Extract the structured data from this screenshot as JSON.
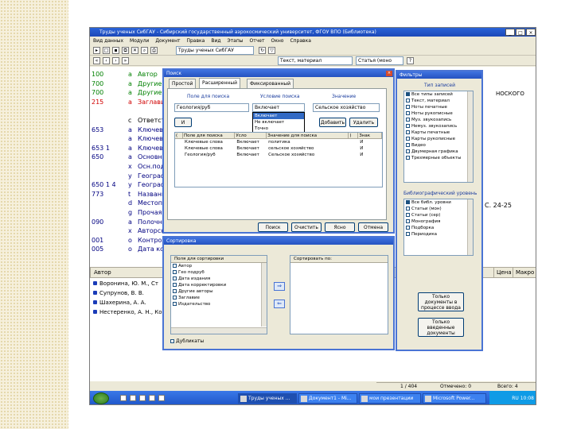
{
  "window": {
    "title": "Труды ученых СибГАУ - Сибирский государственный аэрокосмический университет, ФГОУ ВПО (Библиотека)",
    "menu": [
      "Вид данных",
      "Модули",
      "Документ",
      "Правка",
      "Вид",
      "Этапы",
      "Отчет",
      "Окно",
      "Справка"
    ],
    "toolbar_combo": "Труды ученых СибГАУ",
    "toolbar_combo2": "Текст, материал",
    "toolbar_combo3": "Статья (моно",
    "min": "_",
    "max": "□",
    "close": "×"
  },
  "records": [
    {
      "code": "100",
      "let": "а",
      "text": "Автор",
      "color": "#008000"
    },
    {
      "code": "700",
      "let": "а",
      "text": "Другие",
      "color": "#008000"
    },
    {
      "code": "700",
      "let": "а",
      "text": "Другие",
      "color": "#008000"
    },
    {
      "code": "215",
      "let": "а",
      "text": "Заглавие",
      "color": "#d00000"
    },
    {
      "code": "",
      "let": "",
      "text": "",
      "color": "#000000"
    },
    {
      "code": "",
      "let": "с",
      "text": "Ответств",
      "color": "#000000"
    },
    {
      "code": "653",
      "let": "а",
      "text": "Ключевые",
      "color": "#000080"
    },
    {
      "code": "",
      "let": "а",
      "text": "Ключевые",
      "color": "#000080"
    },
    {
      "code": "653  1",
      "let": "а",
      "text": "Ключевые",
      "color": "#000080"
    },
    {
      "code": "650",
      "let": "а",
      "text": "Основная",
      "color": "#000080"
    },
    {
      "code": "",
      "let": "х",
      "text": "Осн.подр",
      "color": "#000080"
    },
    {
      "code": "",
      "let": "у",
      "text": "Географ",
      "color": "#000080"
    },
    {
      "code": "650  1  4",
      "let": "у",
      "text": "Географ",
      "color": "#000080"
    },
    {
      "code": "773",
      "let": "t",
      "text": "Названи",
      "color": "#000080"
    },
    {
      "code": "",
      "let": "d",
      "text": "Местоп",
      "color": "#000080"
    },
    {
      "code": "",
      "let": "g",
      "text": "Прочая",
      "color": "#000080"
    },
    {
      "code": "090",
      "let": "а",
      "text": "Полочный",
      "color": "#000080"
    },
    {
      "code": "",
      "let": "х",
      "text": "Авторск",
      "color": "#000080"
    },
    {
      "code": "001",
      "let": "о",
      "text": "Контрол",
      "color": "#000080"
    },
    {
      "code": "005",
      "let": "о",
      "text": "Дата ко",
      "color": "#000080"
    }
  ],
  "right_fragments": {
    "f1": "НОСКОГО",
    "f2": "С. 24-25"
  },
  "authors_panel": {
    "header": "Автор",
    "col_price": "Цена",
    "col_macro": "Макро",
    "rows": [
      "Воронина, Ю. М., Ст",
      "Супрунов, В. В.",
      "Шахерина, А. А.",
      "Нестеренко, А. Н., Ко"
    ]
  },
  "status": {
    "pos": "1 / 404",
    "marked": "Отмечено: 0",
    "total": "Всего: 4"
  },
  "taskbar": {
    "items": [
      "Труды ученых ...",
      "Документ1 - Mi...",
      "мои презентации",
      "Microsoft Power..."
    ],
    "time": "RU  10:08"
  },
  "search_dialog": {
    "title": "Поиск",
    "tabs": [
      "Простой",
      "Расширенный",
      "Фиксированный"
    ],
    "label_field": "Поле для поиска",
    "label_condition": "Условие поиска",
    "label_value": "Значение",
    "field_value": "Геология/руб",
    "condition_value": "Включает",
    "value_value": "Сельское хозяйство",
    "op_label": "И",
    "add": "Добавить",
    "delete": "Удалить",
    "condition_options": [
      "Включает",
      "Не включает",
      "Точно",
      "Не равно",
      "Больше"
    ],
    "grid_headers": [
      "(",
      "Поле для поиска",
      "Усло",
      "Значение для поиска",
      ")",
      "Знак"
    ],
    "grid_rows": [
      {
        "field": "Ключевые слова",
        "cond": "Включает",
        "val": "политика",
        "sign": "И"
      },
      {
        "field": "Ключевые слова",
        "cond": "Включает",
        "val": "сельское хозяйство",
        "sign": "И"
      },
      {
        "field": "Геология/руб",
        "cond": "Включает",
        "val": "Сельское хозяйство",
        "sign": "И"
      }
    ],
    "btn_search": "Поиск",
    "btn_reset": "Очистить",
    "btn_ok": "Ясно",
    "btn_cancel": "Отмена"
  },
  "filters_dialog": {
    "title": "Фильтры",
    "label_types": "Тип записей",
    "types": [
      "Все типы записей",
      "Текст, материал",
      "Ноты печатные",
      "Ноты рукописные",
      "Муз. звукозапись",
      "Немуз. звукозапись",
      "Карты печатные",
      "Карты рукописные",
      "Видео",
      "Двумерная графика",
      "Трехмерные объекты"
    ],
    "label_levels": "Библиографический уровень",
    "levels": [
      "Все библ. уровни",
      "Статьи (мон)",
      "Статьи (сер)",
      "Монография",
      "Подборка",
      "Периодика"
    ],
    "btn_incomplete": "Только документы в процессе ввода",
    "btn_completed": "Только введенные документы"
  },
  "sort_dialog": {
    "title": "Сортировка",
    "label_fields": "Поля для сортировки",
    "label_sort": "Сортировать по:",
    "fields": [
      "Автор",
      "Гео подруб",
      "Дата издания",
      "Дата корректировки",
      "Другие авторы",
      "Заглавие",
      "Издательство"
    ],
    "dup_label": "Дубликаты"
  }
}
